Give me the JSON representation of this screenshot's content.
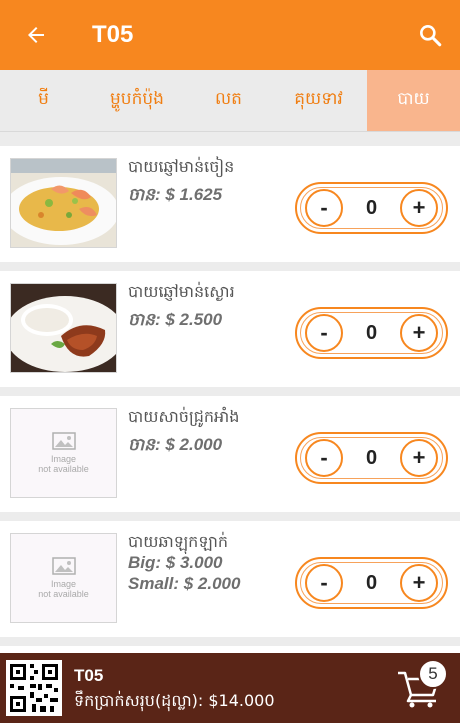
{
  "header": {
    "title": "T05",
    "back_icon": "arrow-left-icon",
    "search_icon": "search-icon"
  },
  "tabs": [
    {
      "label": "មី",
      "active": false
    },
    {
      "label": "ម្ហូបកំប៉ុង",
      "active": false
    },
    {
      "label": "លត",
      "active": false
    },
    {
      "label": "គុយទាវ",
      "active": false
    },
    {
      "label": "បាយ",
      "active": true
    }
  ],
  "items": [
    {
      "name": "បាយឆ្ញៅមាន់ចៀន",
      "prices": [
        "ចាន: $ 1.625"
      ],
      "quantity": "0",
      "image": "fried-rice-shrimp-photo"
    },
    {
      "name": "បាយឆ្ញៅមាន់ស្ងោរ",
      "prices": [
        "ចាន: $ 2.500"
      ],
      "quantity": "0",
      "image": "rice-roast-duck-photo"
    },
    {
      "name": "បាយសាច់ជ្រូកអាំង",
      "prices": [
        "ចាន: $ 2.000"
      ],
      "quantity": "0",
      "image": "image-not-available",
      "image_text": [
        "Image",
        "not available"
      ]
    },
    {
      "name": "បាយឆាឡុកឡាក់",
      "prices": [
        "Big: $ 3.000",
        "Small: $ 2.000"
      ],
      "quantity": "0",
      "image": "image-not-available",
      "image_text": [
        "Image",
        "not available"
      ]
    }
  ],
  "stepper": {
    "minus": "-",
    "plus": "+"
  },
  "footer": {
    "table": "T05",
    "total": "ទឹកប្រាក់សរុប(ដុល្លា): $14.000",
    "cart_count": "5"
  },
  "colors": {
    "accent": "#f7871f",
    "active_tab": "#f9b58d",
    "footer": "#5a2517"
  }
}
